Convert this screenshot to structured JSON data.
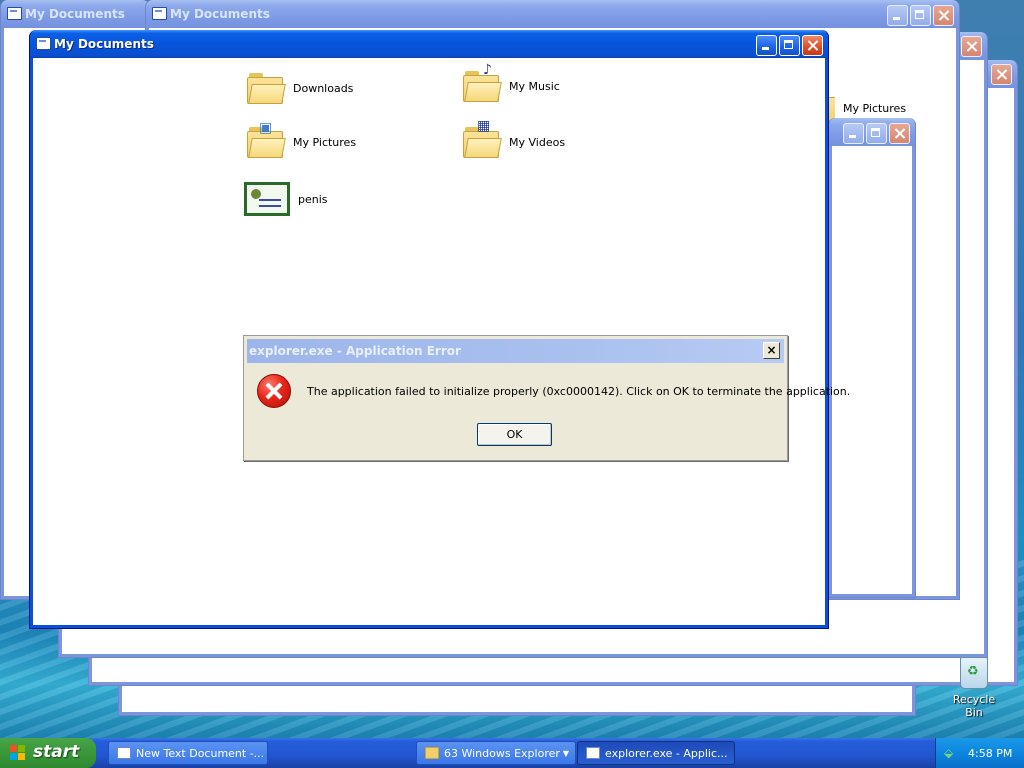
{
  "windows": {
    "back_a": {
      "title": "My Documents"
    },
    "back_b": {
      "title": "My Documents"
    },
    "main": {
      "title": "My Documents"
    },
    "back_pics": {
      "item_label": "My Pictures"
    }
  },
  "folder_items": [
    {
      "label": "Downloads",
      "icon": "folder-icon"
    },
    {
      "label": "My Music",
      "icon": "music-folder-icon"
    },
    {
      "label": "My Pictures",
      "icon": "pictures-folder-icon"
    },
    {
      "label": "My Videos",
      "icon": "videos-folder-icon"
    },
    {
      "label": "penis",
      "icon": "certificate-icon"
    }
  ],
  "dialog": {
    "title": "explorer.exe - Application Error",
    "close_label": "×",
    "message": "The application failed to initialize properly (0xc0000142). Click on OK to terminate the application.",
    "ok_label": "OK",
    "icon": "error-icon"
  },
  "desktop": {
    "recycle_bin_label": "Recycle Bin"
  },
  "taskbar": {
    "start_label": "start",
    "buttons": [
      {
        "label": "New Text Document -...",
        "icon": "notepad-icon"
      },
      {
        "label": "63 Windows Explorer",
        "icon": "folder-icon"
      },
      {
        "label": "explorer.exe - Applic...",
        "icon": "window-icon"
      }
    ],
    "clock": "4:58 PM"
  },
  "colors": {
    "titlebar_active": "#0a5fe6",
    "titlebar_inactive": "#7f9be6",
    "dialog_bg": "#ece9d8",
    "taskbar": "#245edb",
    "start_green": "#3c9a3c"
  }
}
